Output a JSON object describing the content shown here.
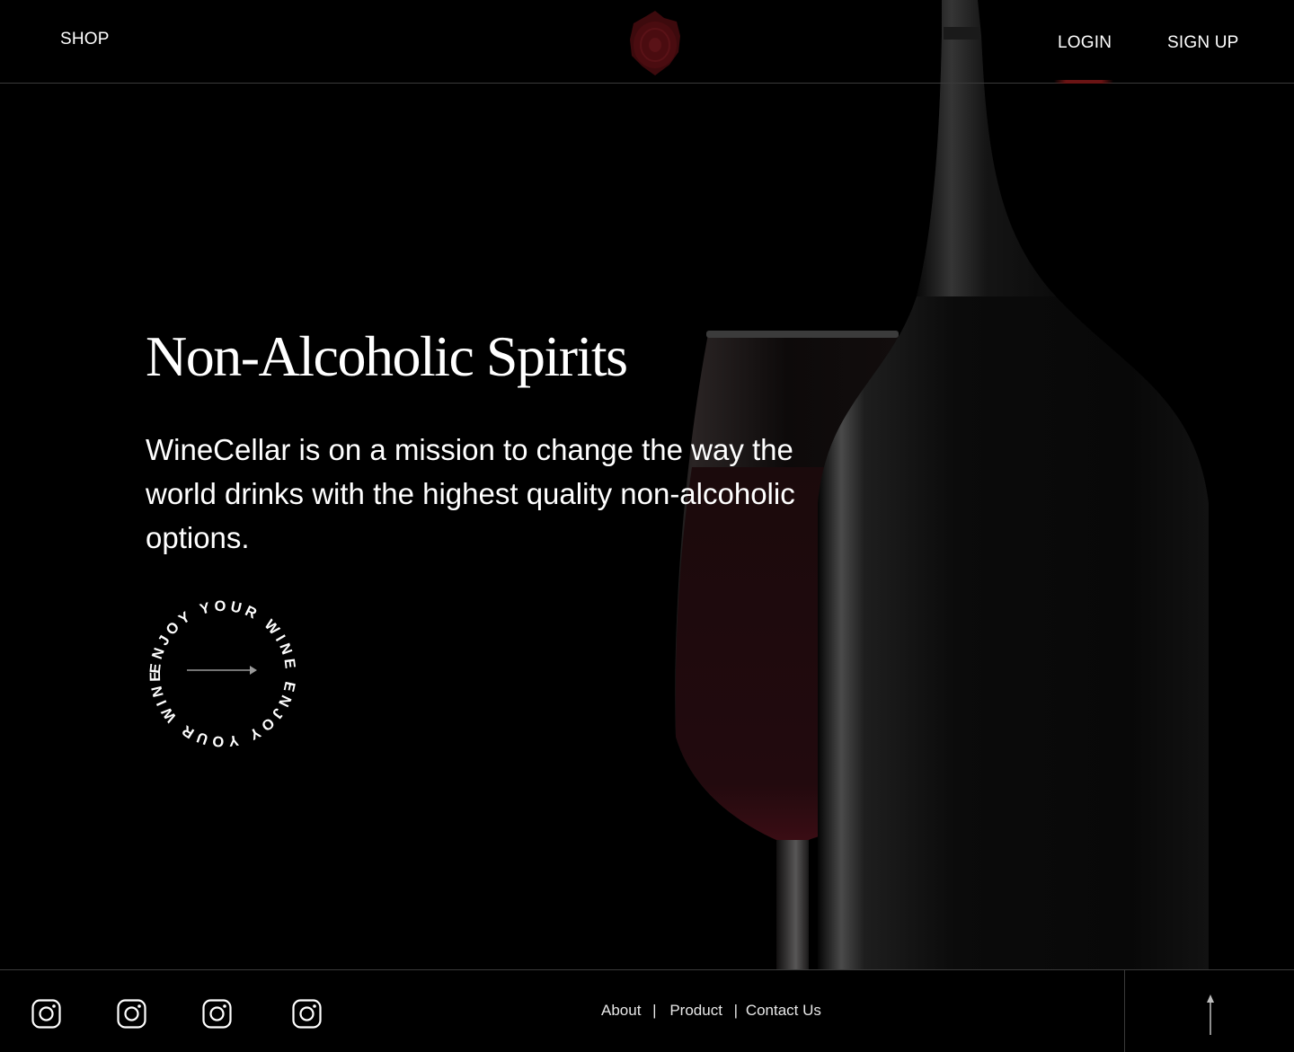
{
  "header": {
    "shop_label": "SHOP",
    "login_label": "LOGIN",
    "signup_label": "SIGN UP",
    "logo_icon": "wax-seal-logo-icon"
  },
  "hero": {
    "title": "Non-Alcoholic Spirits",
    "description": "WineCellar is on a mission to change the way the world drinks with the highest quality non-alcoholic options.",
    "badge_text": "ENJOY YOUR WINE ENJOY YOUR WINE ",
    "badge_icon": "arrow-right-icon"
  },
  "footer": {
    "social_icons": [
      "instagram-icon",
      "instagram-icon",
      "instagram-icon",
      "instagram-icon"
    ],
    "links": [
      "About",
      "Product",
      "Contact Us"
    ],
    "separator": "|",
    "scroll_top_icon": "arrow-up-icon"
  },
  "colors": {
    "background": "#000000",
    "text": "#ffffff",
    "accent": "#6b1414",
    "divider": "#3a3a3a"
  }
}
